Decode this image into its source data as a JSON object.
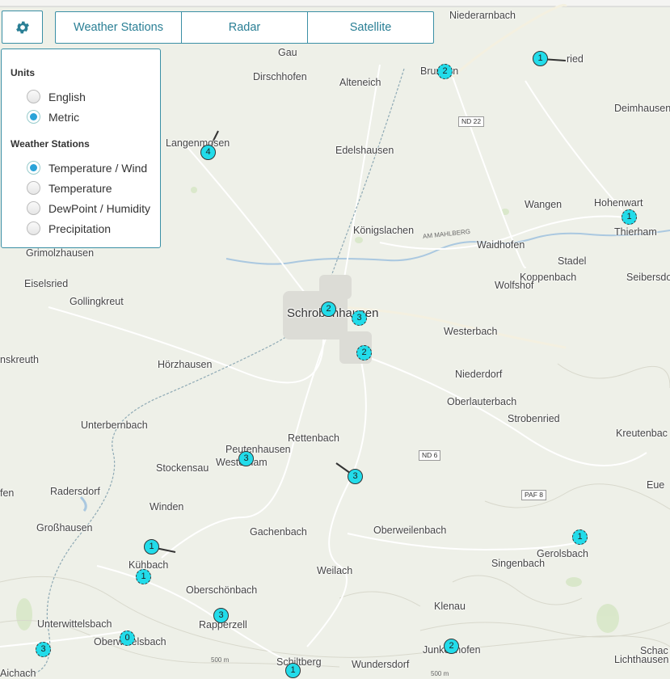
{
  "toolbar": {
    "tabs": [
      "Weather Stations",
      "Radar",
      "Satellite"
    ]
  },
  "panel": {
    "units_heading": "Units",
    "units": [
      {
        "label": "English",
        "selected": false
      },
      {
        "label": "Metric",
        "selected": true
      }
    ],
    "stations_heading": "Weather Stations",
    "stations": [
      {
        "label": "Temperature / Wind",
        "selected": true
      },
      {
        "label": "Temperature",
        "selected": false
      },
      {
        "label": "DewPoint / Humidity",
        "selected": false
      },
      {
        "label": "Precipitation",
        "selected": false
      }
    ]
  },
  "places": [
    "Niederarnbach",
    "Gau",
    "Dirschhofen",
    "Alteneich",
    "Brunnen",
    "ried",
    "Deimhausen",
    "Langenmosen",
    "Edelshausen",
    "Wangen",
    "Hohenwart",
    "Thierham",
    "Königslachen",
    "Waidhofen",
    "Stadel",
    "Koppenbach",
    "Wolfshof",
    "Seibersdo",
    "Grimolzhausen",
    "Eiselsried",
    "Gollingkreut",
    "Schrobenhausen",
    "Westerbach",
    "nskreuth",
    "Hörzhausen",
    "Niederdorf",
    "Oberlauterbach",
    "Strobenried",
    "Kreutenbac",
    "Unterbernbach",
    "Rettenbach",
    "Peutenhausen",
    "Westerham",
    "Stockensau",
    "Radersdorf",
    "fen",
    "Winden",
    "Eue",
    "Großhausen",
    "Gachenbach",
    "Oberweilenbach",
    "Gerolsbach",
    "Singenbach",
    "Kühbach",
    "Weilach",
    "Oberschönbach",
    "Klenau",
    "Unterwittelsbach",
    "Rapperzell",
    "Oberwittelsbach",
    "Junkenhofen",
    "Schac",
    "Lichthausen",
    "Schiltberg",
    "Wundersdorf",
    "Aichach"
  ],
  "roads": [
    "ND 22",
    "AM MAHLBERG",
    "ND 6",
    "PAF 8",
    "500 m",
    "500 m"
  ],
  "markers": [
    "1",
    "2",
    "4",
    "1",
    "2",
    "3",
    "2",
    "3",
    "3",
    "1",
    "1",
    "1",
    "3",
    "3",
    "0",
    "2",
    "1"
  ]
}
